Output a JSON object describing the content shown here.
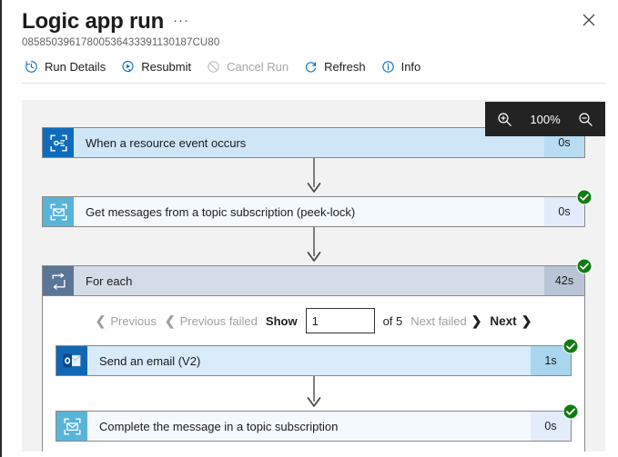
{
  "header": {
    "title": "Logic app run",
    "more_label": "···",
    "run_id": "08585039617800536433391130187CU80",
    "close_icon": "close-icon"
  },
  "toolbar": {
    "items": [
      {
        "label": "Run Details",
        "icon": "history-clock-icon",
        "enabled": true
      },
      {
        "label": "Resubmit",
        "icon": "resubmit-play-icon",
        "enabled": true
      },
      {
        "label": "Cancel Run",
        "icon": "cancel-circle-slash-icon",
        "enabled": false
      },
      {
        "label": "Refresh",
        "icon": "refresh-icon",
        "enabled": true
      },
      {
        "label": "Info",
        "icon": "info-circle-icon",
        "enabled": true
      }
    ]
  },
  "zoom_control": {
    "zoom_in_icon": "zoom-in-magnifier-icon",
    "zoom_out_icon": "zoom-out-magnifier-icon",
    "level": "100%"
  },
  "designer": {
    "trigger": {
      "label": "When a resource event occurs",
      "duration": "0s",
      "icon": "event-grid-icon",
      "status": "succeeded"
    },
    "action_get_messages": {
      "label": "Get messages from a topic subscription (peek-lock)",
      "duration": "0s",
      "icon": "service-bus-icon",
      "status": "succeeded"
    },
    "foreach": {
      "label": "For each",
      "duration": "42s",
      "icon": "foreach-loop-icon",
      "status": "succeeded",
      "pager": {
        "previous": "Previous",
        "previous_failed": "Previous failed",
        "show": "Show",
        "page_value": "1",
        "of_total": "of 5",
        "next_failed": "Next failed",
        "next": "Next"
      },
      "actions": [
        {
          "label": "Send an email (V2)",
          "duration": "1s",
          "icon": "outlook-icon",
          "status": "succeeded"
        },
        {
          "label": "Complete the message in a topic subscription",
          "duration": "0s",
          "icon": "service-bus-icon",
          "status": "succeeded"
        }
      ]
    }
  },
  "colors": {
    "accent": "#0f6cbd",
    "success": "#107c10",
    "service_bus": "#59b4d9",
    "outlook": "#1267b4",
    "foreach": "#5b7596",
    "canvas": "#f2f2f2",
    "zoom_bar": "#232323"
  }
}
